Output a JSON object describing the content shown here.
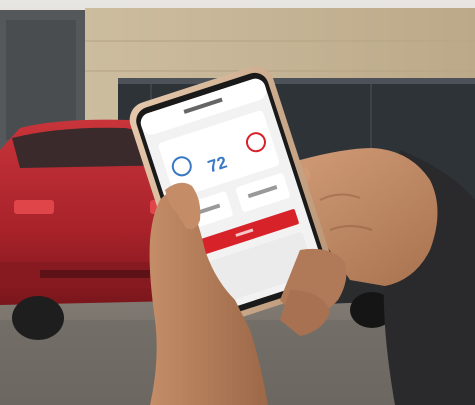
{
  "photo": {
    "subject": "hand-holding-smartphone-remote-climate-app",
    "colors": {
      "car_red": "#b8242a",
      "wall_beige": "#c9b89a",
      "glass_dark": "#2e3338",
      "ground": "#7c7670",
      "skin": "#c58f6b",
      "phone_frame": "#d8b89c",
      "screen_bg": "#f2f2f2",
      "accent_red": "#d8222a",
      "temp_blue": "#3a78c4"
    }
  },
  "phone_screen": {
    "header_title": "",
    "temperature": "72"
  }
}
